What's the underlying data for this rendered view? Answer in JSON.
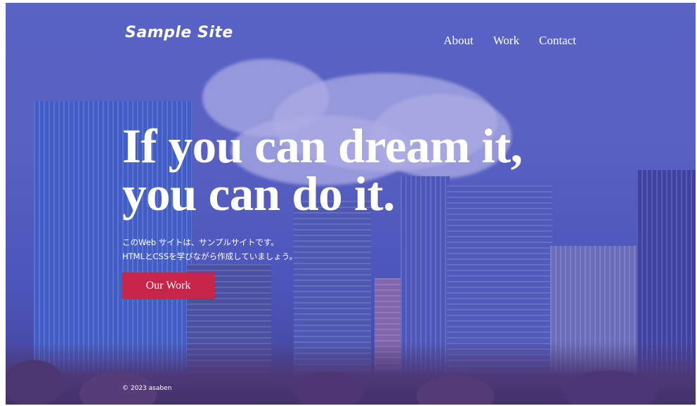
{
  "header": {
    "logo": "Sample Site",
    "nav": [
      {
        "label": "About"
      },
      {
        "label": "Work"
      },
      {
        "label": "Contact"
      }
    ]
  },
  "hero": {
    "title_line1": "If you can dream it,",
    "title_line2": "you can do it.",
    "subtitle_line1": "このWeb サイトは、サンプルサイトです。",
    "subtitle_line2": "HTMLとCSSを学びながら作成していましょう。",
    "cta_label": "Our Work"
  },
  "footer": {
    "copyright": "© 2023 asaben"
  },
  "colors": {
    "cta": "#c7244a",
    "overlay": "#5a5ac8",
    "text": "#ffffff"
  }
}
